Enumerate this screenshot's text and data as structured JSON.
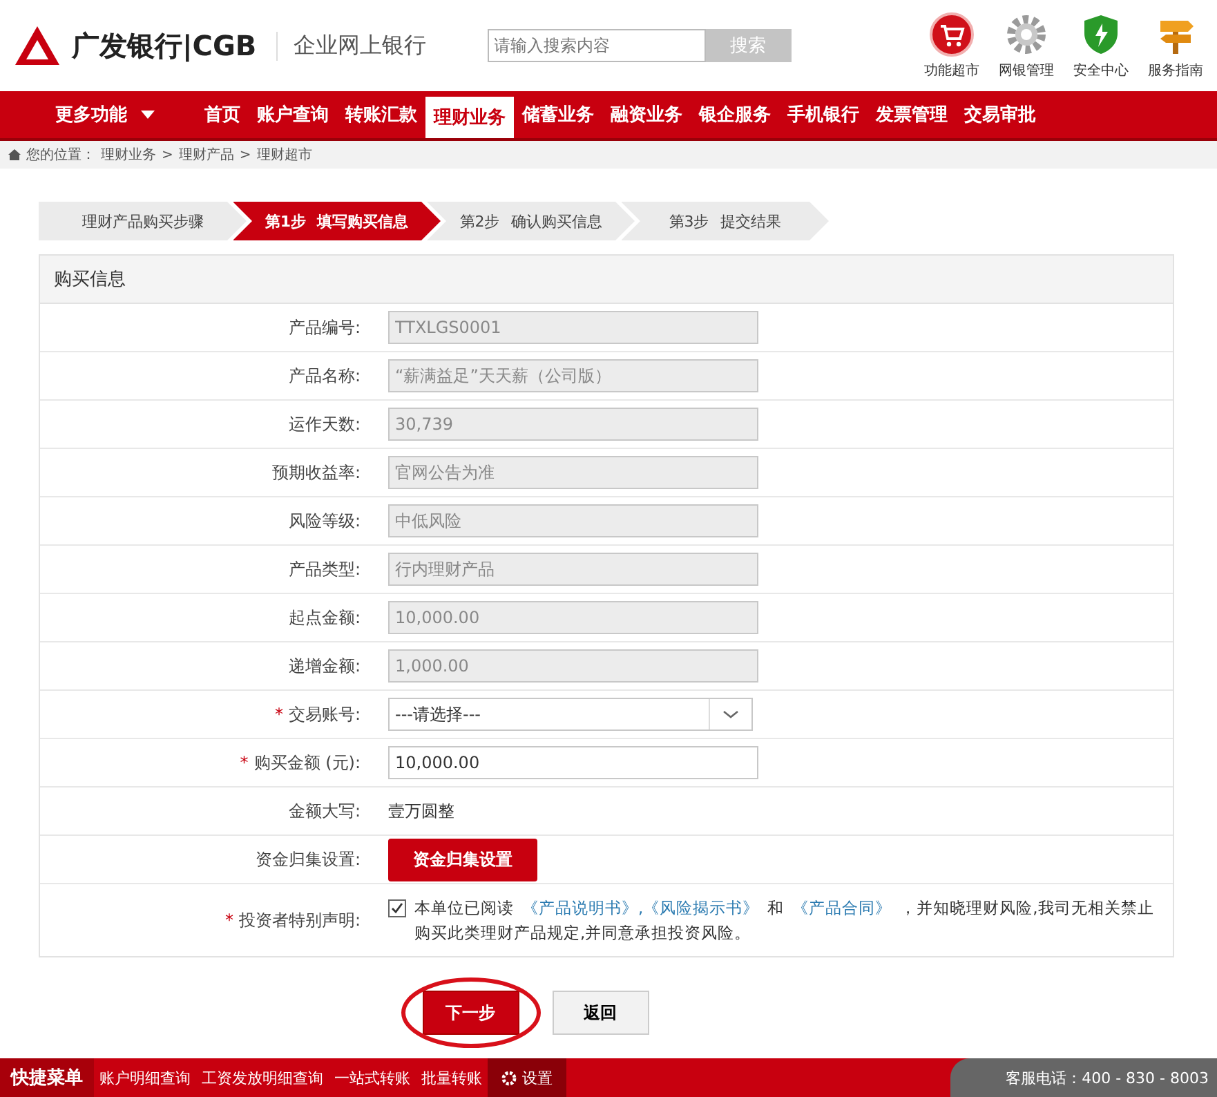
{
  "header": {
    "logo_text": "广发银行|CGB",
    "subtitle": "企业网上银行",
    "search": {
      "placeholder": "请输入搜索内容",
      "button": "搜索"
    },
    "shortcuts": [
      {
        "label": "功能超市"
      },
      {
        "label": "网银管理"
      },
      {
        "label": "安全中心"
      },
      {
        "label": "服务指南"
      }
    ]
  },
  "nav": {
    "more": "更多功能",
    "items": [
      {
        "label": "首页",
        "selected": false
      },
      {
        "label": "账户查询",
        "selected": false
      },
      {
        "label": "转账汇款",
        "selected": false
      },
      {
        "label": "理财业务",
        "selected": true
      },
      {
        "label": "储蓄业务",
        "selected": false
      },
      {
        "label": "融资业务",
        "selected": false
      },
      {
        "label": "银企服务",
        "selected": false
      },
      {
        "label": "手机银行",
        "selected": false
      },
      {
        "label": "发票管理",
        "selected": false
      },
      {
        "label": "交易审批",
        "selected": false
      }
    ]
  },
  "breadcrumb": [
    "您的位置：",
    "理财业务",
    ">",
    "理财产品",
    ">",
    "理财超市"
  ],
  "steps": [
    {
      "label": "理财产品购买步骤",
      "selected": false
    },
    {
      "number": "第1步",
      "label": "填写购买信息",
      "selected": true
    },
    {
      "number": "第2步",
      "label": "确认购买信息",
      "selected": false
    },
    {
      "number": "第3步",
      "label": "提交结果",
      "selected": false
    }
  ],
  "section_title": "购买信息",
  "fields": [
    {
      "kind": "readonly",
      "label": "产品编号:",
      "value": "TTXLGS0001"
    },
    {
      "kind": "readonly",
      "label": "产品名称:",
      "value": "“薪满益足”天天薪（公司版）"
    },
    {
      "kind": "readonly",
      "label": "运作天数:",
      "value": "30,739"
    },
    {
      "kind": "readonly",
      "label": "预期收益率:",
      "value": "官网公告为准"
    },
    {
      "kind": "readonly",
      "label": "风险等级:",
      "value": "中低风险"
    },
    {
      "kind": "readonly",
      "label": "产品类型:",
      "value": "行内理财产品"
    },
    {
      "kind": "readonly",
      "label": "起点金额:",
      "value": "10,000.00"
    },
    {
      "kind": "readonly",
      "label": "递增金额:",
      "value": "1,000.00"
    },
    {
      "kind": "select",
      "label": "交易账号:",
      "value": "---请选择---",
      "required_mark": "*"
    },
    {
      "kind": "input",
      "label": "购买金额 (元):",
      "value": "10,000.00",
      "required_mark": "*"
    },
    {
      "kind": "text",
      "label": "金额大写:",
      "value": "壹万圆整"
    },
    {
      "kind": "button",
      "label": "资金归集设置:",
      "value": "资金归集设置"
    },
    {
      "kind": "declaration",
      "label": "投资者特别声明:",
      "required_mark": "*",
      "checked": true,
      "parts": [
        {
          "text": "本单位已阅读",
          "link": false
        },
        {
          "text": "《产品说明书》,《风险揭示书》",
          "link": true
        },
        {
          "text": "和",
          "link": false
        },
        {
          "text": "《产品合同》",
          "link": true
        },
        {
          "text": "，并知晓理财风险,我司无相关禁止购买此类理财产品规定,并同意承担投资风险。",
          "link": false
        }
      ]
    }
  ],
  "actions": [
    {
      "label": "下一步",
      "kind": "primary",
      "circled": true
    },
    {
      "label": "返回",
      "kind": "secondary",
      "circled": false
    }
  ],
  "footer": {
    "menu": "快捷菜单",
    "links": [
      "账户明细查询",
      "工资发放明细查询",
      "一站式转账",
      "批量转账"
    ],
    "settings": "设置",
    "hotline": "客服电话：400 - 830 - 8003"
  }
}
